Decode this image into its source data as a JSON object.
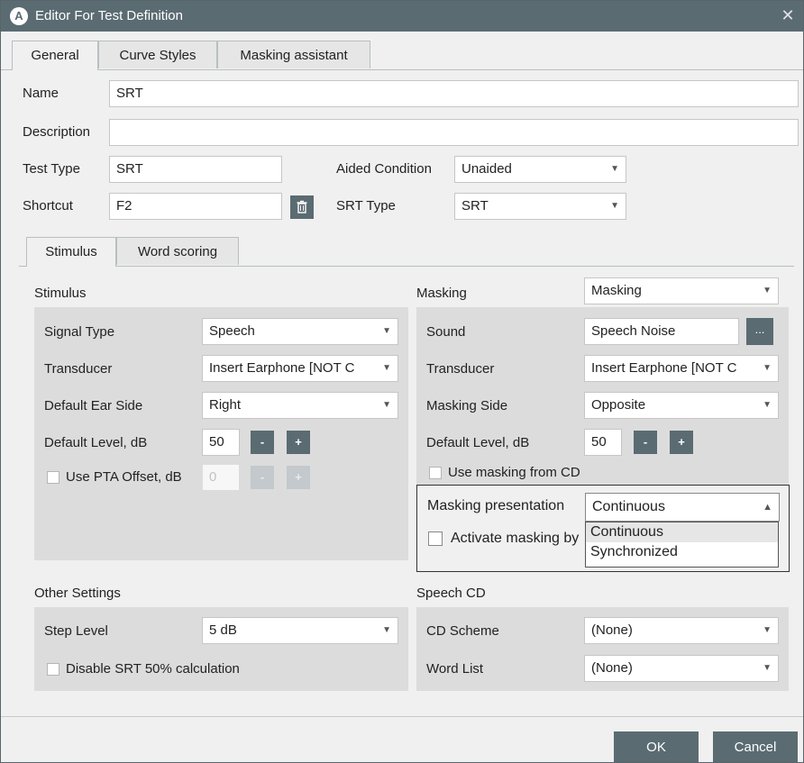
{
  "window": {
    "title": "Editor For Test Definition",
    "app_icon": "A",
    "close_glyph": "✕"
  },
  "tabs": [
    "General",
    "Curve Styles",
    "Masking assistant"
  ],
  "general": {
    "name_label": "Name",
    "name_value": "SRT",
    "description_label": "Description",
    "description_value": "",
    "test_type_label": "Test Type",
    "test_type_value": "SRT",
    "aided_condition_label": "Aided Condition",
    "aided_condition_value": "Unaided",
    "shortcut_label": "Shortcut",
    "shortcut_value": "F2",
    "srt_type_label": "SRT Type",
    "srt_type_value": "SRT"
  },
  "subtabs": [
    "Stimulus",
    "Word scoring"
  ],
  "stimulus": {
    "title": "Stimulus",
    "signal_type_label": "Signal Type",
    "signal_type_value": "Speech",
    "transducer_label": "Transducer",
    "transducer_value": "Insert Earphone [NOT C",
    "ear_side_label": "Default Ear Side",
    "ear_side_value": "Right",
    "level_label": "Default Level, dB",
    "level_value": "50",
    "pta_label": "Use PTA Offset, dB",
    "pta_value": "0"
  },
  "masking": {
    "title": "Masking",
    "mode_value": "Masking",
    "sound_label": "Sound",
    "sound_value": "Speech Noise",
    "browse_label": "...",
    "transducer_label": "Transducer",
    "transducer_value": "Insert Earphone [NOT C",
    "side_label": "Masking Side",
    "side_value": "Opposite",
    "level_label": "Default Level, dB",
    "level_value": "50",
    "from_cd_label": "Use masking from CD",
    "presentation_label": "Masking presentation",
    "presentation_value": "Continuous",
    "activate_label": "Activate masking by",
    "presentation_options": [
      "Continuous",
      "Synchronized"
    ]
  },
  "other": {
    "title": "Other Settings",
    "step_label": "Step Level",
    "step_value": "5 dB",
    "disable_label": "Disable SRT 50% calculation"
  },
  "speech_cd": {
    "title": "Speech CD",
    "scheme_label": "CD Scheme",
    "scheme_value": "(None)",
    "wordlist_label": "Word List",
    "wordlist_value": "(None)"
  },
  "stepper": {
    "minus": "-",
    "plus": "+"
  },
  "footer": {
    "ok": "OK",
    "cancel": "Cancel"
  },
  "colors": {
    "titlebar": "#5b6b72",
    "accent_button": "#5b6b72",
    "panel": "#dcdcdc"
  }
}
